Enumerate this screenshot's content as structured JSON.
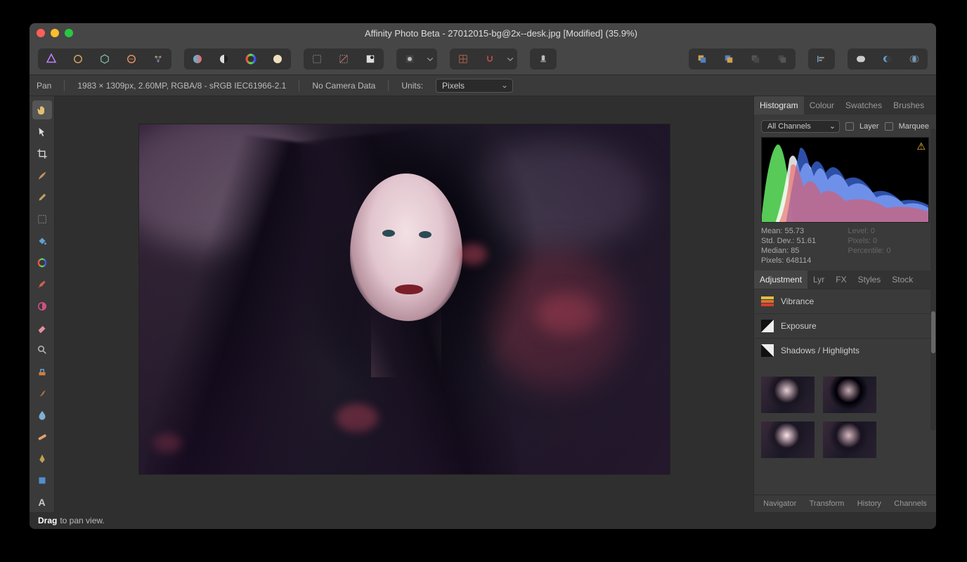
{
  "window": {
    "title": "Affinity Photo Beta - 27012015-bg@2x--desk.jpg [Modified] (35.9%)"
  },
  "infobar": {
    "tool": "Pan",
    "doc": "1983 × 1309px, 2.60MP, RGBA/8 - sRGB IEC61966-2.1",
    "camera": "No Camera Data",
    "units_label": "Units:",
    "units_value": "Pixels"
  },
  "right": {
    "top_tabs": [
      "Histogram",
      "Colour",
      "Swatches",
      "Brushes"
    ],
    "top_active": "Histogram",
    "channels": "All Channels",
    "layer_label": "Layer",
    "marquee_label": "Marquee",
    "stats": {
      "mean": "Mean: 55.73",
      "stddev": "Std. Dev.: 51.61",
      "median": "Median: 85",
      "pixels": "Pixels: 648114",
      "level": "Level: 0",
      "px2": "Pixels: 0",
      "percentile": "Percentile: 0"
    },
    "mid_tabs": [
      "Adjustment",
      "Lyr",
      "FX",
      "Styles",
      "Stock"
    ],
    "mid_active": "Adjustment",
    "adjustments": [
      "Vibrance",
      "Exposure",
      "Shadows / Highlights"
    ],
    "bottom_tabs": [
      "Navigator",
      "Transform",
      "History",
      "Channels"
    ]
  },
  "status": {
    "action": "Drag",
    "hint": "to pan view."
  }
}
